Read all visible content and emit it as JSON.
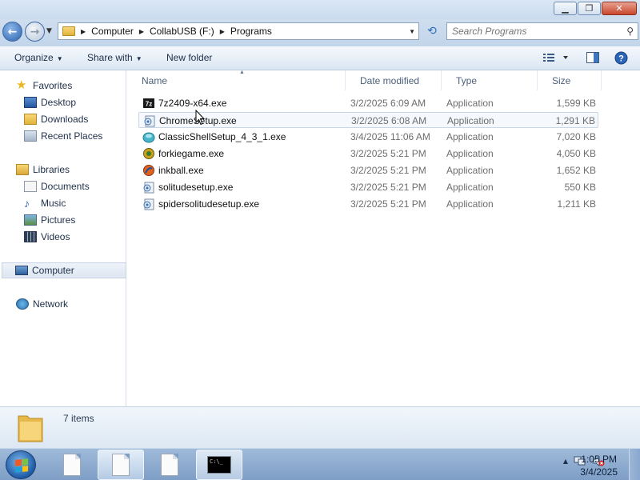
{
  "window": {
    "buttons": {
      "minimize": "▁",
      "maximize": "❐",
      "close": "✕"
    }
  },
  "address": {
    "crumbs": [
      "Computer",
      "CollabUSB (F:)",
      "Programs"
    ]
  },
  "search": {
    "placeholder": "Search Programs"
  },
  "toolbar": {
    "organize": "Organize",
    "share_with": "Share with",
    "new_folder": "New folder"
  },
  "navpane": {
    "favorites": {
      "label": "Favorites",
      "items": [
        "Desktop",
        "Downloads",
        "Recent Places"
      ]
    },
    "libraries": {
      "label": "Libraries",
      "items": [
        "Documents",
        "Music",
        "Pictures",
        "Videos"
      ]
    },
    "computer": "Computer",
    "network": "Network"
  },
  "columns": {
    "name": "Name",
    "date": "Date modified",
    "type": "Type",
    "size": "Size"
  },
  "files": [
    {
      "name": "7z2409-x64.exe",
      "date": "3/2/2025 6:09 AM",
      "type": "Application",
      "size": "1,599 KB",
      "icon": "7zip-icon"
    },
    {
      "name": "ChromeSetup.exe",
      "date": "3/2/2025 6:08 AM",
      "type": "Application",
      "size": "1,291 KB",
      "icon": "setup-icon"
    },
    {
      "name": "ClassicShellSetup_4_3_1.exe",
      "date": "3/4/2025 11:06 AM",
      "type": "Application",
      "size": "7,020 KB",
      "icon": "shell-icon"
    },
    {
      "name": "forkiegame.exe",
      "date": "3/2/2025 5:21 PM",
      "type": "Application",
      "size": "4,050 KB",
      "icon": "game-icon"
    },
    {
      "name": "inkball.exe",
      "date": "3/2/2025 5:21 PM",
      "type": "Application",
      "size": "1,652 KB",
      "icon": "inkball-icon"
    },
    {
      "name": "solitudesetup.exe",
      "date": "3/2/2025 5:21 PM",
      "type": "Application",
      "size": "550 KB",
      "icon": "setup-icon"
    },
    {
      "name": "spidersolitudesetup.exe",
      "date": "3/2/2025 5:21 PM",
      "type": "Application",
      "size": "1,211 KB",
      "icon": "setup-icon"
    }
  ],
  "details": {
    "count": "7 items"
  },
  "taskbar": {
    "cmd_text": "C:\\_",
    "time": "1:05 PM",
    "date": "3/4/2025"
  }
}
